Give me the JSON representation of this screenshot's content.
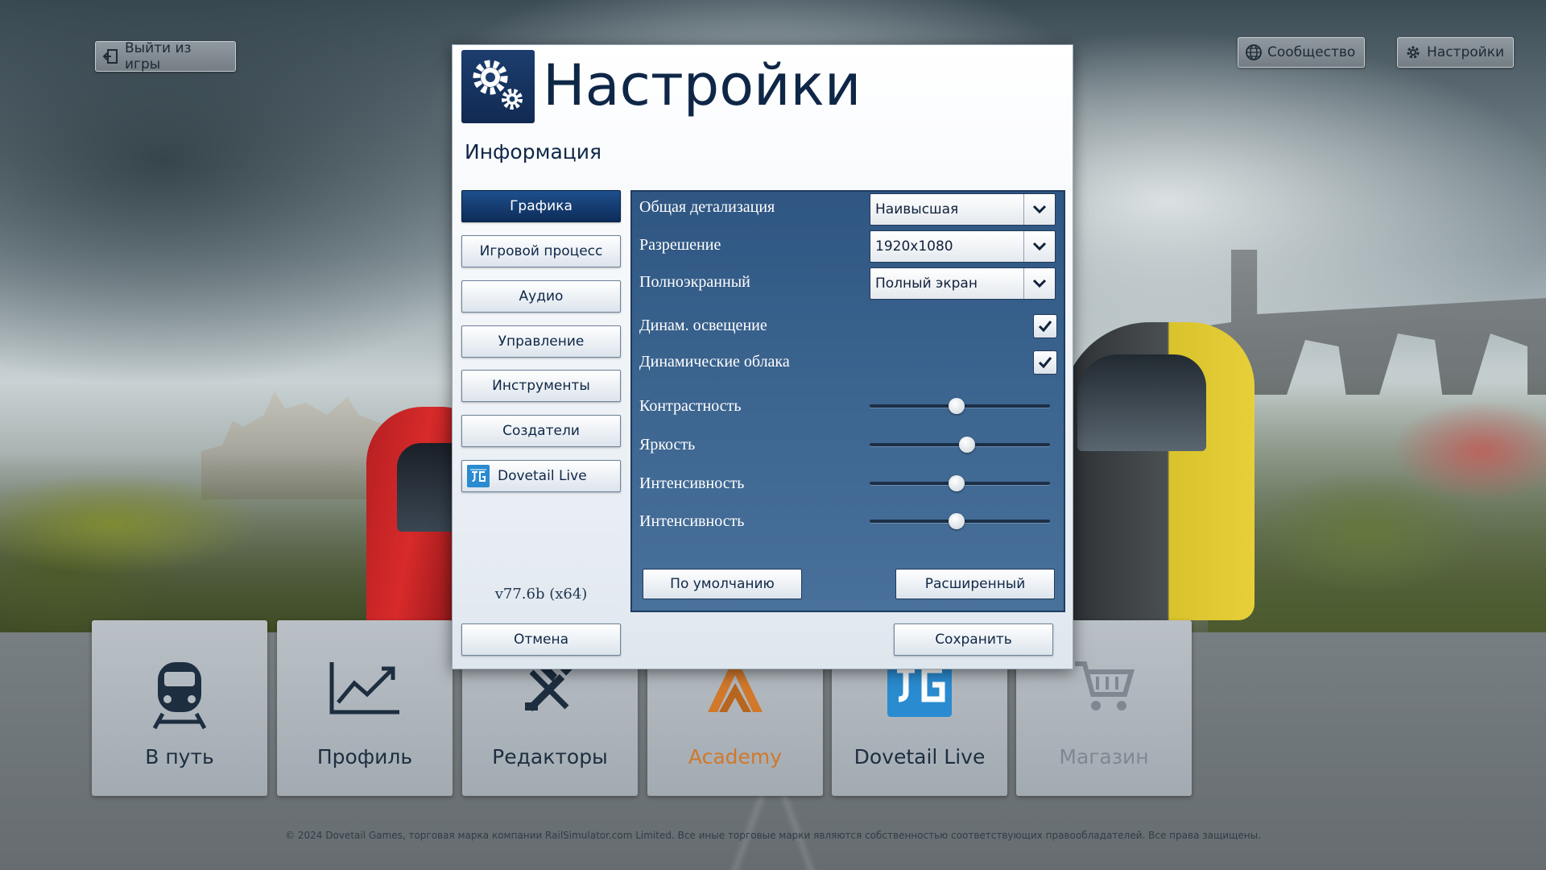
{
  "top_bar": {
    "exit_label": "Выйти из игры",
    "community_label": "Сообщество",
    "settings_label": "Настройки"
  },
  "tiles": [
    {
      "label": "В путь",
      "icon": "train-icon",
      "color": "#1d2e40"
    },
    {
      "label": "Профиль",
      "icon": "chart-line-icon",
      "color": "#1d2e40"
    },
    {
      "label": "Редакторы",
      "icon": "tools-icon",
      "color": "#1d2e40"
    },
    {
      "label": "Academy",
      "icon": "academy-logo",
      "color": "#d1782b"
    },
    {
      "label": "Dovetail Live",
      "icon": "dovetail-live-logo",
      "color": "#1d2e40"
    },
    {
      "label": "Магазин",
      "icon": "cart-icon",
      "color": "#7f8891"
    }
  ],
  "copyright": "© 2024 Dovetail Games, торговая марка компании RailSimulator.com Limited. Все иные торговые марки являются собственностью соответствующих правообладателей. Все права защищены.",
  "dialog": {
    "title": "Настройки",
    "subtitle": "Информация",
    "version": "v77.6b (x64)",
    "sidebar": [
      {
        "label": "Графика",
        "active": true
      },
      {
        "label": "Игровой процесс",
        "active": false
      },
      {
        "label": "Аудио",
        "active": false
      },
      {
        "label": "Управление",
        "active": false
      },
      {
        "label": "Инструменты",
        "active": false
      },
      {
        "label": "Создатели",
        "active": false
      },
      {
        "label": "Dovetail Live",
        "active": false
      }
    ],
    "graphics": {
      "detail": {
        "label": "Общая детализация",
        "value": "Наивысшая"
      },
      "resolution": {
        "label": "Разрешение",
        "value": "1920x1080"
      },
      "fullscreen": {
        "label": "Полноэкранный",
        "value": "Полный экран"
      },
      "dyn_lighting": {
        "label": "Динам. освещение",
        "checked": true
      },
      "dyn_clouds": {
        "label": "Динамические облака",
        "checked": true
      },
      "contrast": {
        "label": "Контрастность",
        "value": 0.48
      },
      "brightness": {
        "label": "Яркость",
        "value": 0.54
      },
      "intensity_1": {
        "label": "Интенсивность",
        "value": 0.48
      },
      "intensity_2": {
        "label": "Интенсивность",
        "value": 0.48
      }
    },
    "buttons": {
      "defaults": "По умолчанию",
      "advanced": "Расширенный",
      "cancel": "Отмена",
      "save": "Сохранить"
    },
    "colors": {
      "accent": "#0f2747",
      "active_tab": "#1d4f8c",
      "panel": "#3c6590"
    }
  }
}
